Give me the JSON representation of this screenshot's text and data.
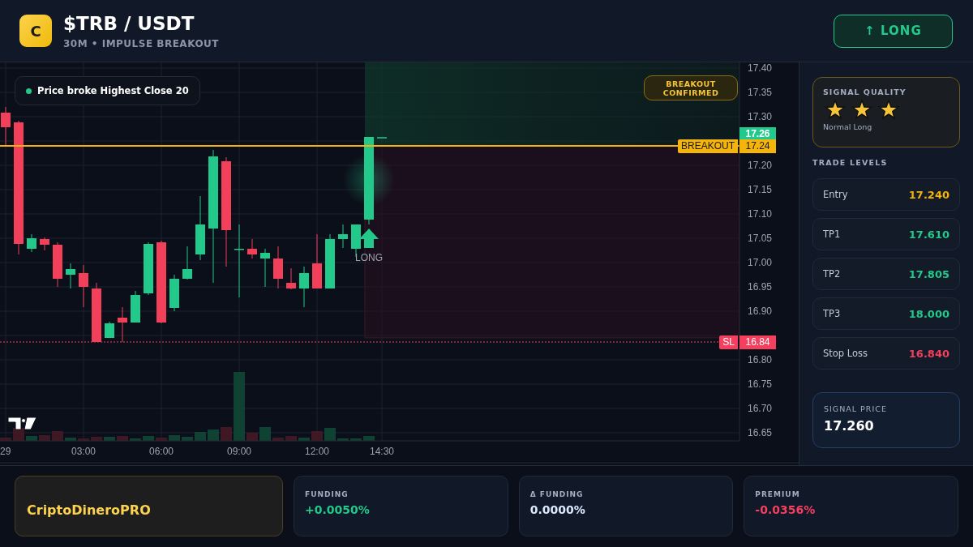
{
  "header": {
    "logo": "C",
    "title": "$TRB / USDT",
    "subtitle": "30M • IMPULSE BREAKOUT",
    "action": {
      "label": "↑ LONG",
      "kind": "long"
    }
  },
  "chart": {
    "legend": "Price broke Highest Close 20",
    "badge": "BREAKOUT CONFIRMED",
    "price_axis": [
      [
        "17.40",
        "17.35",
        "17.30"
      ],
      [
        "17.20",
        "17.15",
        "17.10",
        "17.05",
        "17.00",
        "16.95",
        "16.90"
      ],
      [
        "16.80",
        "16.75",
        "16.70",
        "16.65"
      ]
    ],
    "time_axis": [
      "29",
      "03:00",
      "06:00",
      "09:00",
      "12:00",
      "14:30"
    ],
    "last_price": "17.26",
    "levels": [
      {
        "kind": "breakout",
        "label": "BREAKOUT",
        "price": "17.24"
      },
      {
        "kind": "stop",
        "label": "SL",
        "price": "16.84"
      }
    ],
    "signal": {
      "kind": "long",
      "label": "LONG"
    }
  },
  "signal_quality": {
    "title": "SIGNAL QUALITY",
    "stars": 3,
    "caption": "Normal Long"
  },
  "trade_levels": {
    "title": "TRADE LEVELS",
    "items": [
      {
        "label": "Entry",
        "value": "17.240",
        "color": "#f5b40a"
      },
      {
        "label": "TP1",
        "value": "17.610",
        "color": "#22c98a"
      },
      {
        "label": "TP2",
        "value": "17.805",
        "color": "#22c98a"
      },
      {
        "label": "TP3",
        "value": "18.000",
        "color": "#22c98a"
      },
      {
        "label": "Stop Loss",
        "value": "16.840",
        "color": "#f43f5e"
      }
    ]
  },
  "signal_price": {
    "label": "SIGNAL PRICE",
    "value": "17.260"
  },
  "footer": {
    "brand": "CriptoDineroPRO",
    "stats": [
      {
        "label": "FUNDING",
        "value": "+0.0050%",
        "color": "#22c98a"
      },
      {
        "label": "Δ FUNDING",
        "value": "0.0000%",
        "color": "#dbeafe"
      },
      {
        "label": "PREMIUM",
        "value": "-0.0356%",
        "color": "#f43f5e"
      }
    ]
  }
}
